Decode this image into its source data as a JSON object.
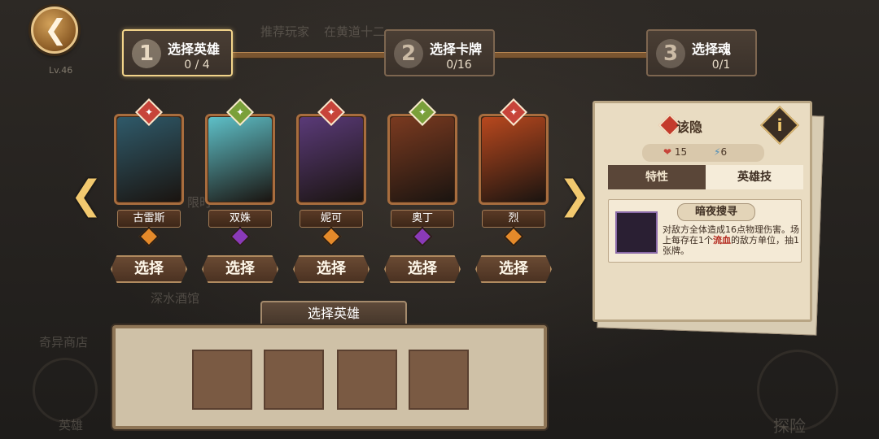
{
  "header": {
    "back_icon": "chevron-left-icon",
    "level": "Lv.46",
    "bg_texts": [
      "推荐玩家",
      "在黄道十二",
      "深水酒馆",
      "奇异商店",
      "英雄",
      "探险",
      "限时"
    ]
  },
  "steps": [
    {
      "num": "1",
      "title": "选择英雄",
      "count": "0 / 4",
      "active": true
    },
    {
      "num": "2",
      "title": "选择卡牌",
      "count": "0/16",
      "active": false
    },
    {
      "num": "3",
      "title": "选择魂",
      "count": "0/1",
      "active": false
    }
  ],
  "heroes": [
    {
      "name": "古雷斯",
      "select_label": "选择",
      "pin_color": "#c7443a",
      "gem_color": "#e58a2a",
      "portrait_color": "#2f5a6a"
    },
    {
      "name": "双姝",
      "select_label": "选择",
      "pin_color": "#7aa03a",
      "gem_color": "#8a3ab8",
      "portrait_color": "#5ec0c8"
    },
    {
      "name": "妮可",
      "select_label": "选择",
      "pin_color": "#c7443a",
      "gem_color": "#e58a2a",
      "portrait_color": "#5a3a78"
    },
    {
      "name": "奥丁",
      "select_label": "选择",
      "pin_color": "#7aa03a",
      "gem_color": "#8a3ab8",
      "portrait_color": "#7a3a20"
    },
    {
      "name": "烈",
      "select_label": "选择",
      "pin_color": "#c7443a",
      "gem_color": "#e58a2a",
      "portrait_color": "#b8481e"
    }
  ],
  "selection": {
    "label": "选择英雄",
    "slot_count": 4
  },
  "info": {
    "title": "该隐",
    "hp": "15",
    "energy": "6",
    "tab_traits": "特性",
    "tab_skill": "英雄技",
    "skill_name": "暗夜搜寻",
    "skill_desc_1": "对敌方全体造成16点物理伤害。场上每存在1个",
    "skill_desc_highlight": "流血",
    "skill_desc_2": "的敌方单位，抽1张牌。",
    "info_button": "i"
  }
}
